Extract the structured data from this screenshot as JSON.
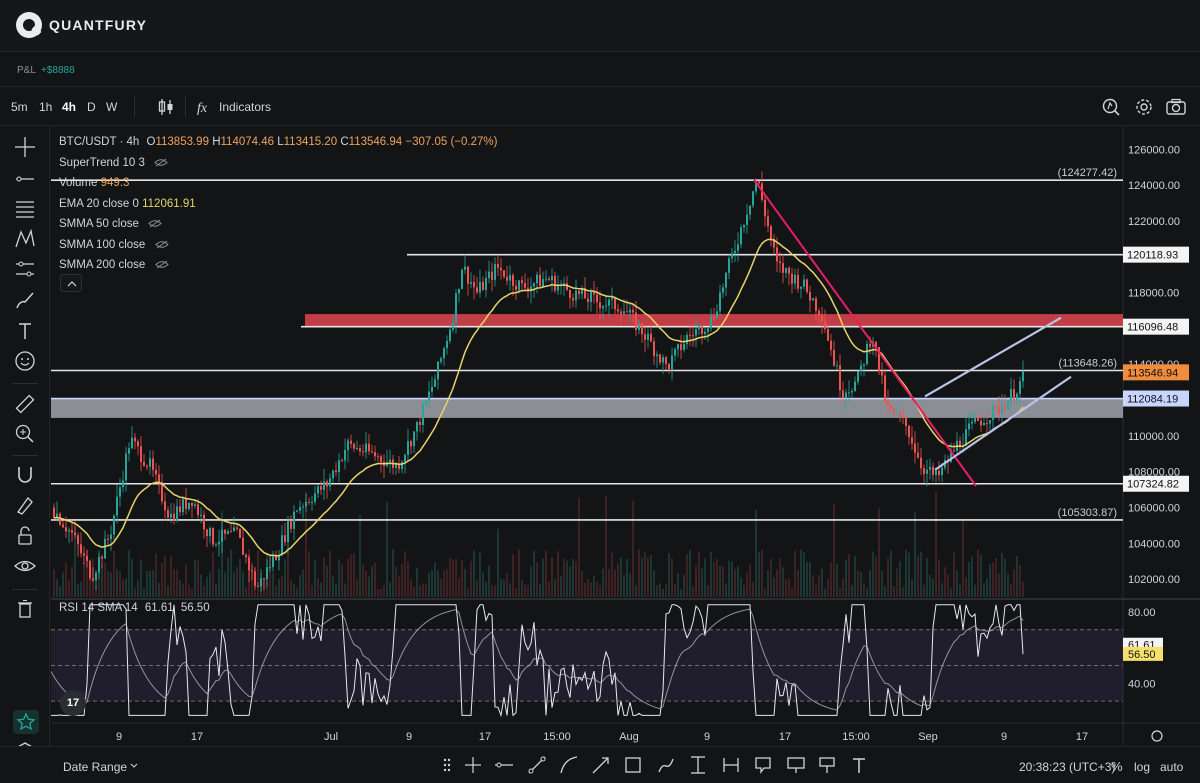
{
  "brand": {
    "name": "QUANTFURY"
  },
  "pnl": {
    "label": "P&L",
    "value": "+$8888"
  },
  "toolbar": {
    "timeframes": [
      "5m",
      "1h",
      "4h",
      "D",
      "W"
    ],
    "active_timeframe": "4h",
    "indicators_label": "Indicators"
  },
  "legend": {
    "symbol": "BTC/USDT · 4h",
    "o_label": "O",
    "o": "113853.99",
    "h_label": "H",
    "h": "114074.46",
    "l_label": "L",
    "l": "113415.20",
    "c_label": "C",
    "c": "113546.94",
    "change": "−307.05 (−0.27%)",
    "supertrend": "SuperTrend 10 3",
    "volume_label": "Volume",
    "volume_value": "949.3",
    "ema_label": "EMA 20 close 0",
    "ema_value": "112061.91",
    "smma50": "SMMA 50 close",
    "smma100": "SMMA 100 close",
    "smma200": "SMMA 200 close"
  },
  "rsi_legend": {
    "label": "RSI 14 SMA 14",
    "v1": "61.61",
    "v2": "56.50"
  },
  "price_axis": {
    "ticks": [
      "126000.00",
      "124000.00",
      "122000.00",
      "120000.00",
      "118000.00",
      "116000.00",
      "114000.00",
      "112000.00",
      "110000.00",
      "108000.00",
      "106000.00",
      "104000.00",
      "102000.00"
    ],
    "tags": [
      {
        "text": "(124277.42)",
        "style": "plain",
        "price": 124277.42
      },
      {
        "text": "120118.93",
        "style": "white",
        "price": 120118.93
      },
      {
        "text": "116096.48",
        "style": "white",
        "price": 116096.48
      },
      {
        "text": "(113648.26)",
        "style": "plain",
        "price": 113648.26
      },
      {
        "text": "113546.94",
        "style": "orange",
        "price": 113546.94
      },
      {
        "text": "112084.19",
        "style": "lightblue",
        "price": 112084.19
      },
      {
        "text": "107324.82",
        "style": "white",
        "price": 107324.82
      },
      {
        "text": "(105303.87)",
        "style": "plain",
        "price": 105303.87
      }
    ]
  },
  "rsi_axis": {
    "ticks": [
      "80.00",
      "40.00"
    ],
    "tags": [
      {
        "text": "61.61",
        "style": "white"
      },
      {
        "text": "56.50",
        "style": "yellow"
      }
    ]
  },
  "time_axis": {
    "labels": [
      "9",
      "17",
      "Jul",
      "9",
      "17",
      "15:00",
      "Aug",
      "9",
      "17",
      "15:00",
      "Sep",
      "9",
      "17"
    ]
  },
  "bottom": {
    "date_range": "Date Range",
    "clock": "20:38:23 (UTC+3)",
    "pct": "%",
    "log": "log",
    "auto": "auto"
  },
  "tv_logo": "17",
  "colors": {
    "up": "#26a69a",
    "down": "#ef5350",
    "ema": "#e8d36a",
    "trendline": "#e91e63",
    "channel": "#b8c4e8",
    "zone_red": "#e0454f",
    "zone_gray": "#b4b8c0"
  },
  "chart_data": {
    "type": "candlestick",
    "symbol": "BTC/USDT",
    "interval": "4h",
    "ylim": [
      101000,
      126800
    ],
    "rsi_ylim": [
      20,
      85
    ],
    "horizontal_levels": [
      124277.42,
      120118.93,
      116096.48,
      113648.26,
      112084.19,
      107324.82,
      105303.87
    ],
    "zones": [
      {
        "from": 116096.48,
        "to": 116800,
        "color": "red"
      },
      {
        "from": 111000,
        "to": 112084.19,
        "color": "gray"
      }
    ],
    "last_price": 113546.94,
    "ema20": 112061.91,
    "rsi": 61.61,
    "rsi_sma": 56.5
  }
}
